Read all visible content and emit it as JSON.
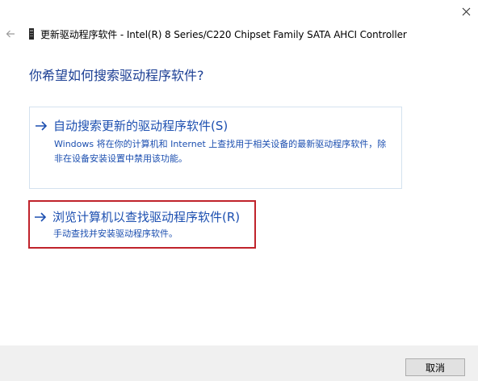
{
  "window": {
    "title": "更新驱动程序软件 - Intel(R) 8 Series/C220 Chipset Family SATA AHCI Controller"
  },
  "icons": {
    "close": "close-icon",
    "back": "back-arrow-icon",
    "device": "device-icon",
    "option_arrow": "arrow-right-icon"
  },
  "main": {
    "question": "你希望如何搜索驱动程序软件?",
    "options": [
      {
        "title": "自动搜索更新的驱动程序软件(S)",
        "description": "Windows 将在你的计算机和 Internet 上查找用于相关设备的最新驱动程序软件，除非在设备安装设置中禁用该功能。"
      },
      {
        "title": "浏览计算机以查找驱动程序软件(R)",
        "description": "手动查找并安装驱动程序软件。"
      }
    ]
  },
  "footer": {
    "cancel_label": "取消"
  },
  "colors": {
    "link_blue": "#1c4fb0",
    "heading_blue": "#1c3f94",
    "highlight_red": "#c0232b",
    "option_border": "#d4e2ef",
    "footer_bg": "#f0f0f0"
  }
}
